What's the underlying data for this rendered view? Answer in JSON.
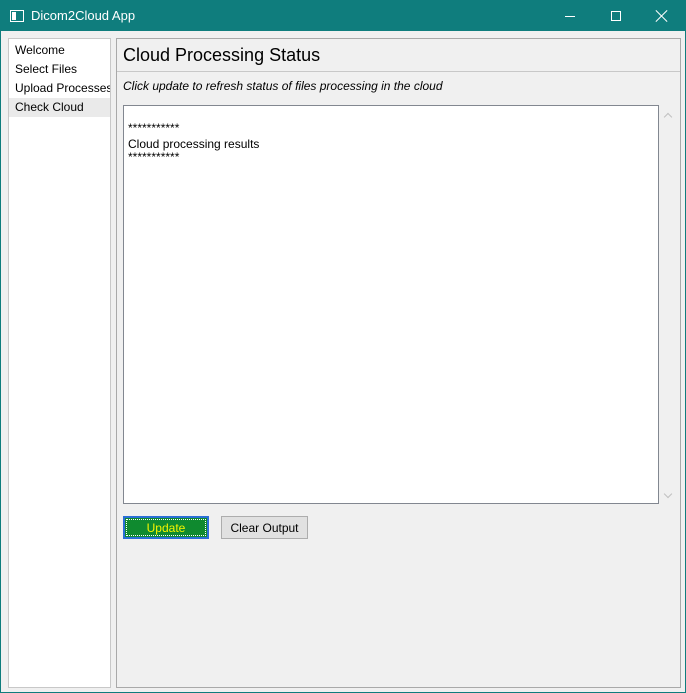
{
  "window": {
    "title": "Dicom2Cloud App",
    "titlebar_color": "#0f7d7d"
  },
  "sidebar": {
    "items": [
      {
        "label": "Welcome"
      },
      {
        "label": "Select Files"
      },
      {
        "label": "Upload Processes"
      },
      {
        "label": "Check Cloud"
      }
    ],
    "active_index": 3
  },
  "main": {
    "title": "Cloud Processing Status",
    "subtitle": "Click update to refresh status of files processing in the cloud",
    "output": {
      "lines": [
        "***********",
        "Cloud processing results",
        "***********"
      ]
    },
    "buttons": {
      "update_label": "Update",
      "clear_label": "Clear Output"
    },
    "update_button_color": "#0f8a2f",
    "update_button_text_color": "#f4f400"
  },
  "icons": {
    "app": "app-window-icon",
    "minimize": "minimize-icon",
    "maximize": "maximize-icon",
    "close": "close-icon",
    "scroll_up": "chevron-up-icon",
    "scroll_down": "chevron-down-icon"
  }
}
